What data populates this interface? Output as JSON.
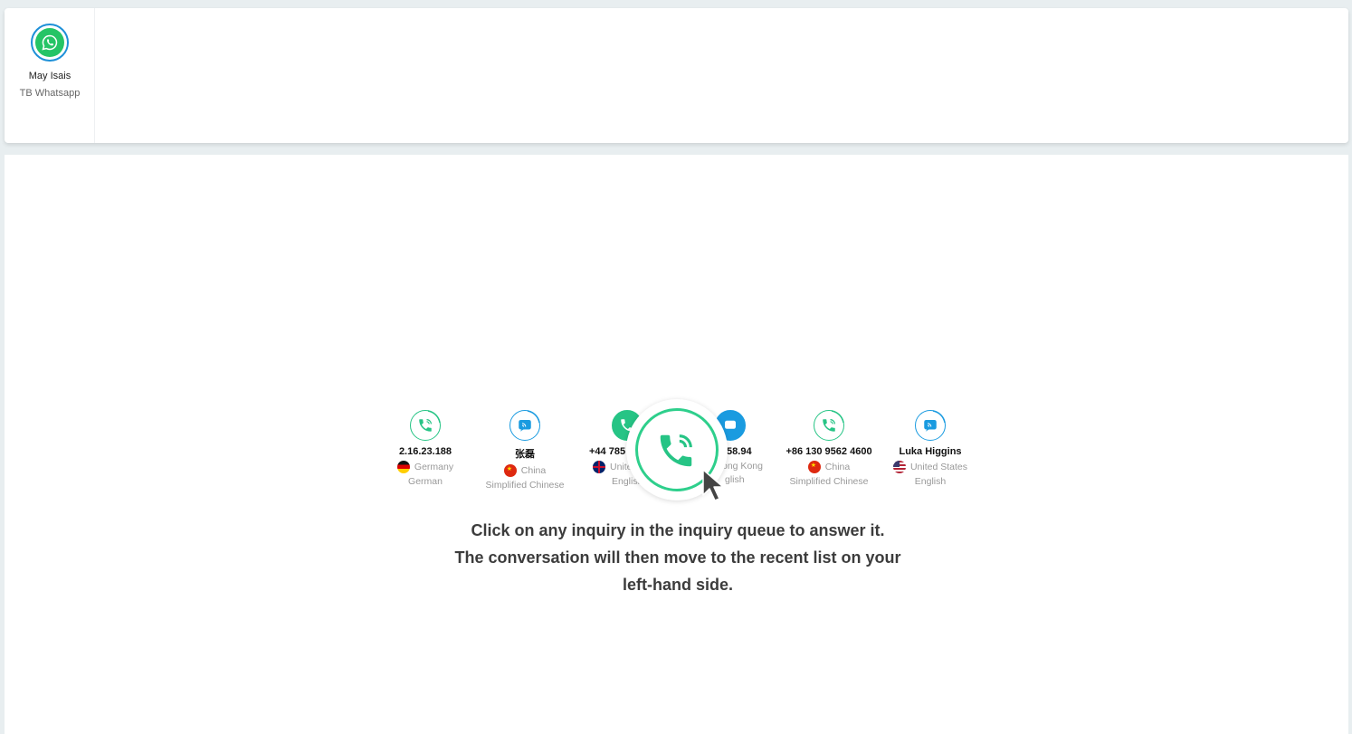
{
  "agent": {
    "name": "May Isais",
    "channel": "TB Whatsapp",
    "icon": "whatsapp-icon"
  },
  "queue": [
    {
      "title": "2.16.23.188",
      "country": "Germany",
      "language": "German",
      "channel": "call",
      "flag": "germany-flag"
    },
    {
      "title": "张磊",
      "country": "China",
      "language": "Simplified Chinese",
      "channel": "chat",
      "flag": "china-flag"
    },
    {
      "title": "+44 785",
      "country": "Unite",
      "language": "English",
      "channel": "call",
      "flag": "uk-flag"
    },
    {
      "title": ".58.94",
      "country": "ong Kong",
      "language": "glish",
      "channel": "chat",
      "flag": "hong-kong-flag"
    },
    {
      "title": "+86 130 9562 4600",
      "country": "China",
      "language": "Simplified Chinese",
      "channel": "call",
      "flag": "china-flag"
    },
    {
      "title": "Luka Higgins",
      "country": "United States",
      "language": "English",
      "channel": "chat",
      "flag": "us-flag"
    }
  ],
  "message": {
    "line1": "Click on any inquiry in the inquiry queue to answer it.",
    "line2": "The conversation will then move to the recent list on your",
    "line3": "left-hand side."
  },
  "colors": {
    "call_green": "#26c485",
    "chat_blue": "#1a9be0",
    "whatsapp_green": "#25c466"
  }
}
